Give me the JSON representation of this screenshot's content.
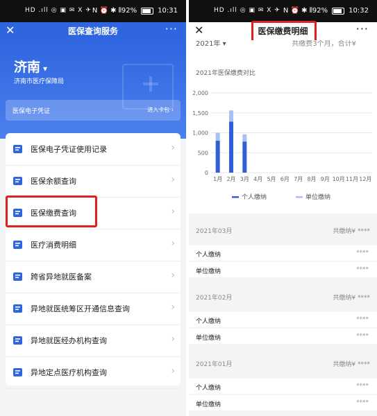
{
  "left": {
    "status": {
      "left_text": "HD .ıll ◎ ▣ ✉ 𝖷 ✈",
      "right_text": "N ⏰ ✱ ⫴92%",
      "time": "10:31"
    },
    "navbar": {
      "title": "医保查询服务",
      "more": "···",
      "close": "✕"
    },
    "city": "济南",
    "bureau": "济南市医疗保障局",
    "credential": {
      "label": "医保电子凭证",
      "action": "进入卡包 ›"
    },
    "menu": [
      {
        "label": "医保电子凭证使用记录",
        "icon": "record-icon"
      },
      {
        "label": "医保余额查询",
        "icon": "balance-icon"
      },
      {
        "label": "医保缴费查询",
        "icon": "payment-icon"
      },
      {
        "label": "医疗消费明细",
        "icon": "consumption-icon"
      },
      {
        "label": "跨省异地就医备案",
        "icon": "filing-icon"
      },
      {
        "label": "异地就医统筹区开通信息查询",
        "icon": "region-icon"
      },
      {
        "label": "异地就医经办机构查询",
        "icon": "agency-icon"
      },
      {
        "label": "异地定点医疗机构查询",
        "icon": "hospital-icon"
      }
    ]
  },
  "right": {
    "status": {
      "left_text": "HD .ıll ◎ ▣ ✉ 𝖷 ✈",
      "right_text": "N ⏰ ✱ ⫴92%",
      "time": "10:32"
    },
    "navbar": {
      "title": "医保缴费明细",
      "more": "···",
      "close": "✕"
    },
    "year": "2021年 ▾",
    "total": "共缴费3个月，合计¥",
    "sections": [
      {
        "month": "2021年03月",
        "total": "共缴纳¥ ****",
        "rows": [
          {
            "label": "个人缴纳",
            "value": "****"
          },
          {
            "label": "单位缴纳",
            "value": "****"
          }
        ]
      },
      {
        "month": "2021年02月",
        "total": "共缴纳¥ ****",
        "rows": [
          {
            "label": "个人缴纳",
            "value": "****"
          },
          {
            "label": "单位缴纳",
            "value": "****"
          }
        ]
      },
      {
        "month": "2021年01月",
        "total": "共缴纳¥ ****",
        "rows": [
          {
            "label": "个人缴纳",
            "value": "****"
          },
          {
            "label": "单位缴纳",
            "value": "****"
          }
        ]
      }
    ]
  },
  "chart_data": {
    "type": "bar",
    "title": "2021年医保缴费对比",
    "categories": [
      "1月",
      "2月",
      "3月",
      "4月",
      "5月",
      "6月",
      "7月",
      "8月",
      "9月",
      "10月",
      "11月",
      "12月"
    ],
    "series": [
      {
        "name": "个人缴纳",
        "values": [
          800,
          1280,
          780,
          0,
          0,
          0,
          0,
          0,
          0,
          0,
          0,
          0
        ],
        "color": "#2f5fd6"
      },
      {
        "name": "单位缴纳",
        "values": [
          200,
          280,
          180,
          0,
          0,
          0,
          0,
          0,
          0,
          0,
          0,
          0
        ],
        "color": "#a8c0f2"
      }
    ],
    "ylim": [
      0,
      2000
    ],
    "yticks": [
      "0",
      "500",
      "1,000",
      "1,500",
      "2,000"
    ],
    "legend": "bottom",
    "stacked": true,
    "grid": true
  },
  "colors": {
    "primary": "#2f66e0",
    "highlight": "#e02020"
  }
}
